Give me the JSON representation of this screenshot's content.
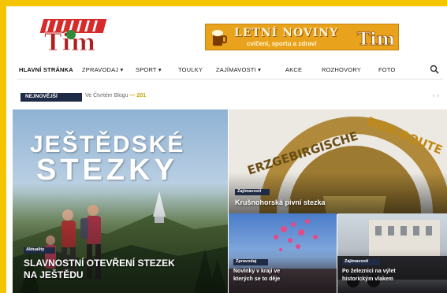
{
  "logo": {
    "text": "Tim"
  },
  "banner": {
    "title": "LETNÍ NOVINY",
    "subtitle": "cvičení, sportu a zdraví",
    "brand": "Tim"
  },
  "nav": {
    "items": [
      {
        "label": "HLAVNÍ STRÁNKA",
        "active": true
      },
      {
        "label": "ZPRAVODAJ ▾"
      },
      {
        "label": "SPORT ▾"
      },
      {
        "label": "TOULKY"
      },
      {
        "label": "ZAJÍMAVOSTI ▾"
      },
      {
        "label": "AKCE"
      },
      {
        "label": "ROZHOVORY"
      },
      {
        "label": "FOTO"
      }
    ]
  },
  "ticker": {
    "badge": "NEJNOVĚJŠÍ",
    "text": "Ve Čtvrtém Blogu",
    "highlight": "— 201"
  },
  "tiles": {
    "main": {
      "hero_line1": "JEŠTĚDSKÉ",
      "hero_line2": "STEZKY",
      "badge": "Aktuality",
      "caption_line1": "SLAVNOSTNÍ OTEVŘENÍ STEZEK",
      "caption_line2": "NA JEŠTĚDU"
    },
    "right": {
      "sign_left": "ERZGEBIRGISCHE",
      "sign_right": "BIER-ROUTE",
      "badge": "Zajímavosti",
      "caption": "Krušnohorská pivní stezka"
    },
    "small1": {
      "badge": "Zpravodaj",
      "caption_line1": "Novinky v kraji ve",
      "caption_line2": "kterých se to děje"
    },
    "small2": {
      "badge": "Zajímavosti",
      "caption_line1": "Po železnici na výlet",
      "caption_line2": "historickým vlakem"
    }
  },
  "colors": {
    "frame": "#f5c400",
    "badge": "#1f2a44",
    "accent": "#c8a000"
  }
}
